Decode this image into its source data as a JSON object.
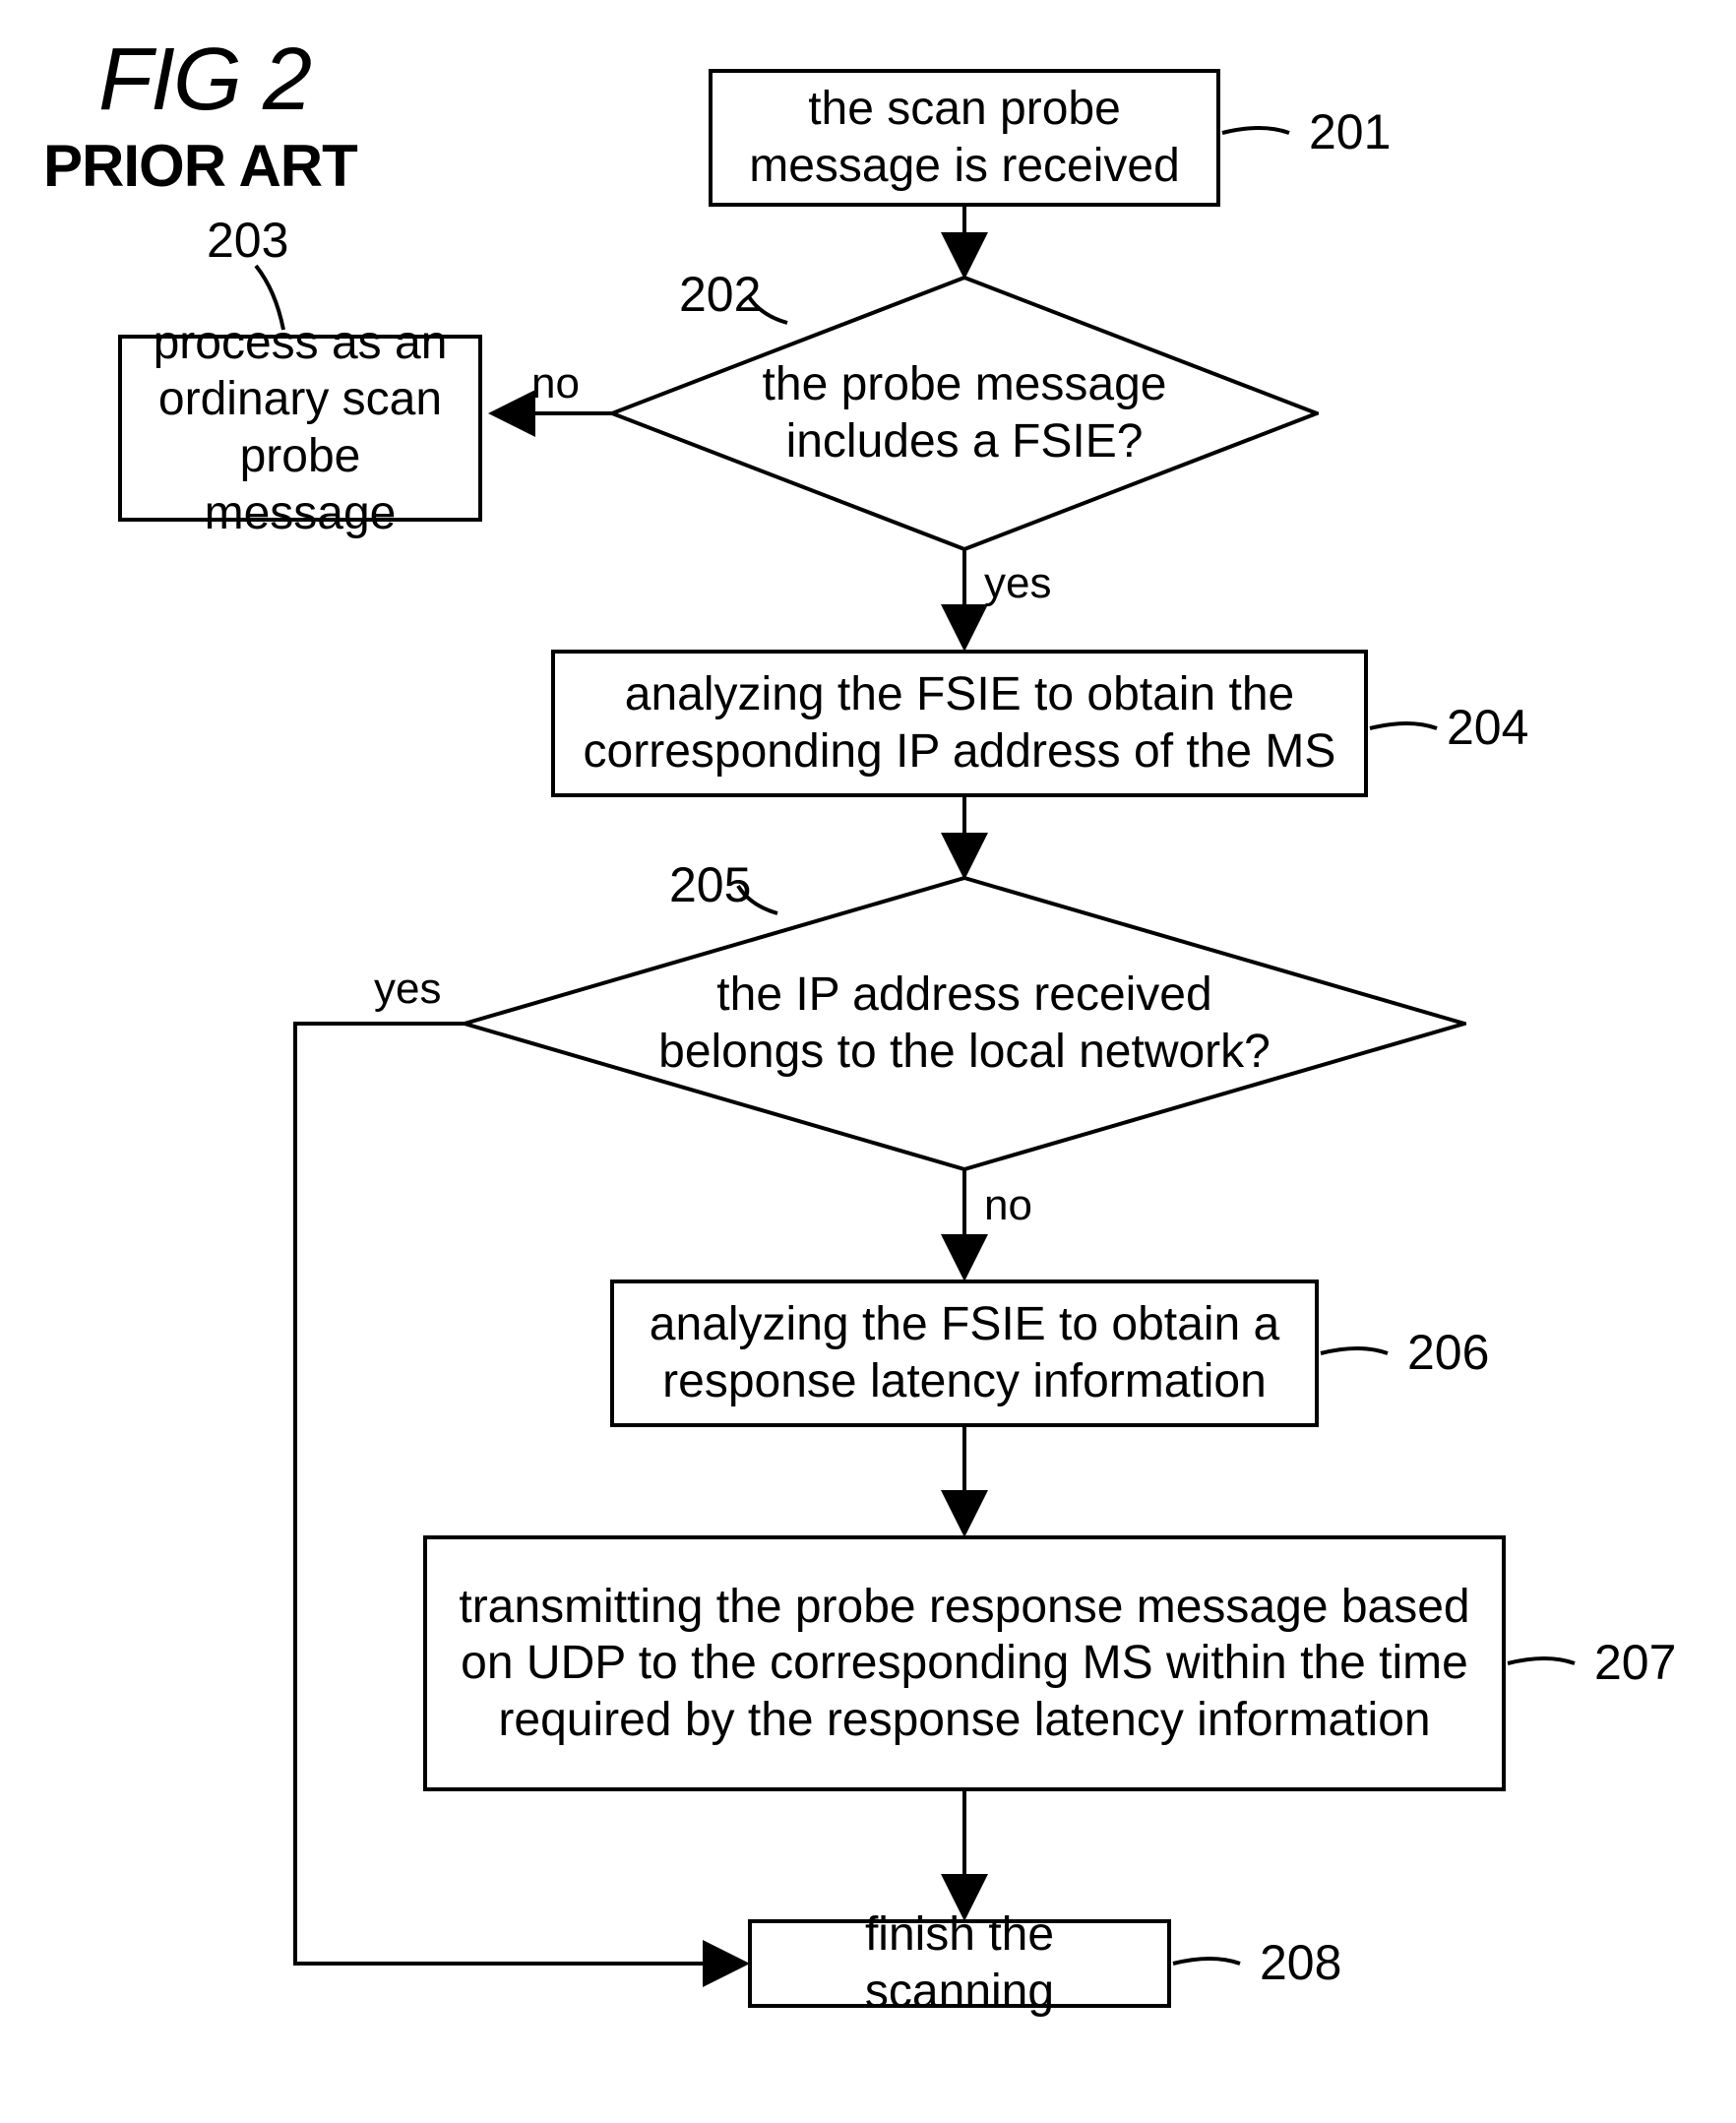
{
  "title": "FIG 2",
  "subtitle": "PRIOR ART",
  "nodes": {
    "n201": {
      "text": "the scan probe message is received",
      "ref": "201"
    },
    "n202": {
      "text": "the probe message includes a FSIE?",
      "ref": "202"
    },
    "n203": {
      "text": "process as an ordinary scan probe message",
      "ref": "203"
    },
    "n204": {
      "text": "analyzing the FSIE to obtain the corresponding IP address of the MS",
      "ref": "204"
    },
    "n205": {
      "text": "the IP address received belongs to the local network?",
      "ref": "205"
    },
    "n206": {
      "text": "analyzing the FSIE to obtain a response latency information",
      "ref": "206"
    },
    "n207": {
      "text": "transmitting the probe response message based on UDP to the corresponding MS within the time required by the response latency information",
      "ref": "207"
    },
    "n208": {
      "text": "finish the scanning",
      "ref": "208"
    }
  },
  "edges": {
    "no": "no",
    "yes": "yes"
  }
}
